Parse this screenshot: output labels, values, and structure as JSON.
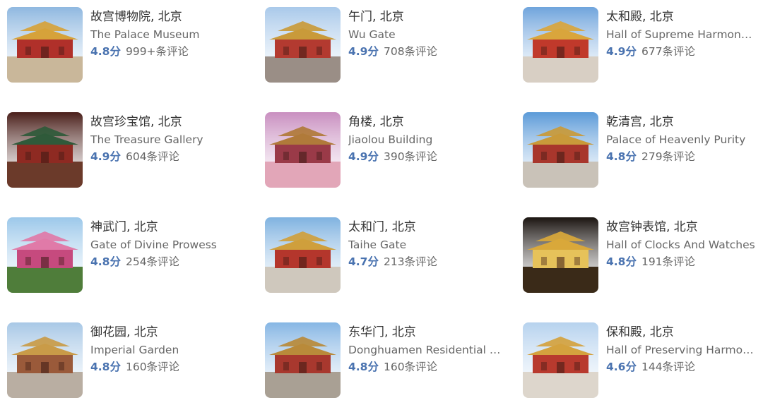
{
  "attractions": [
    {
      "title": "故宫博物院, 北京",
      "subtitle": "The Palace Museum",
      "score": "4.8分",
      "reviews": "999+条评论",
      "thumb": {
        "sky": "#8fb8e0",
        "ground": "#c9b79a",
        "roof": "#d6a23a",
        "wall": "#b0302a"
      }
    },
    {
      "title": "午门, 北京",
      "subtitle": "Wu Gate",
      "score": "4.9分",
      "reviews": "708条评论",
      "thumb": {
        "sky": "#a9c9ea",
        "ground": "#9a8e86",
        "roof": "#c99a3a",
        "wall": "#b33a30"
      }
    },
    {
      "title": "太和殿, 北京",
      "subtitle": "Hall of Supreme Harmony (...",
      "score": "4.9分",
      "reviews": "677条评论",
      "thumb": {
        "sky": "#6fa4dc",
        "ground": "#d8cfc4",
        "roof": "#d9a53c",
        "wall": "#c0392b"
      }
    },
    {
      "title": "故宫珍宝馆, 北京",
      "subtitle": "The Treasure Gallery",
      "score": "4.9分",
      "reviews": "604条评论",
      "thumb": {
        "sky": "#4a1f1a",
        "ground": "#6b3a2a",
        "roof": "#2f5a3a",
        "wall": "#8e2a22"
      }
    },
    {
      "title": "角楼, 北京",
      "subtitle": "Jiaolou Building",
      "score": "4.9分",
      "reviews": "390条评论",
      "thumb": {
        "sky": "#c98fc0",
        "ground": "#e2a6b8",
        "roof": "#b07a3a",
        "wall": "#9a3a48"
      }
    },
    {
      "title": "乾清宫, 北京",
      "subtitle": "Palace of Heavenly Purity",
      "score": "4.8分",
      "reviews": "279条评论",
      "thumb": {
        "sky": "#5b9ad8",
        "ground": "#c9c2b8",
        "roof": "#c99a3a",
        "wall": "#a8362c"
      }
    },
    {
      "title": "神武门, 北京",
      "subtitle": "Gate of Divine Prowess",
      "score": "4.8分",
      "reviews": "254条评论",
      "thumb": {
        "sky": "#9cc8ea",
        "ground": "#4f7d3a",
        "roof": "#e07aa8",
        "wall": "#c64a7e"
      }
    },
    {
      "title": "太和门, 北京",
      "subtitle": "Taihe Gate",
      "score": "4.7分",
      "reviews": "213条评论",
      "thumb": {
        "sky": "#7fb2e0",
        "ground": "#cfc8bd",
        "roof": "#cf9f3c",
        "wall": "#b4362c"
      }
    },
    {
      "title": "故宫钟表馆, 北京",
      "subtitle": "Hall of Clocks And Watches",
      "score": "4.8分",
      "reviews": "191条评论",
      "thumb": {
        "sky": "#1a1410",
        "ground": "#3a2a18",
        "roof": "#d9a83a",
        "wall": "#e6c25a"
      }
    },
    {
      "title": "御花园, 北京",
      "subtitle": "Imperial Garden",
      "score": "4.8分",
      "reviews": "160条评论",
      "thumb": {
        "sky": "#a8c8e6",
        "ground": "#b9aea2",
        "roof": "#c99b48",
        "wall": "#9a5a3a"
      }
    },
    {
      "title": "东华门, 北京",
      "subtitle": "Donghuamen Residential Di...",
      "score": "4.8分",
      "reviews": "160条评论",
      "thumb": {
        "sky": "#86b6e4",
        "ground": "#a9a094",
        "roof": "#b98a3a",
        "wall": "#a8382e"
      }
    },
    {
      "title": "保和殿, 北京",
      "subtitle": "Hall of Preserving Harmony...",
      "score": "4.6分",
      "reviews": "144条评论",
      "thumb": {
        "sky": "#b6d2ee",
        "ground": "#ddd6cc",
        "roof": "#d4a23e",
        "wall": "#b83a2e"
      }
    }
  ]
}
